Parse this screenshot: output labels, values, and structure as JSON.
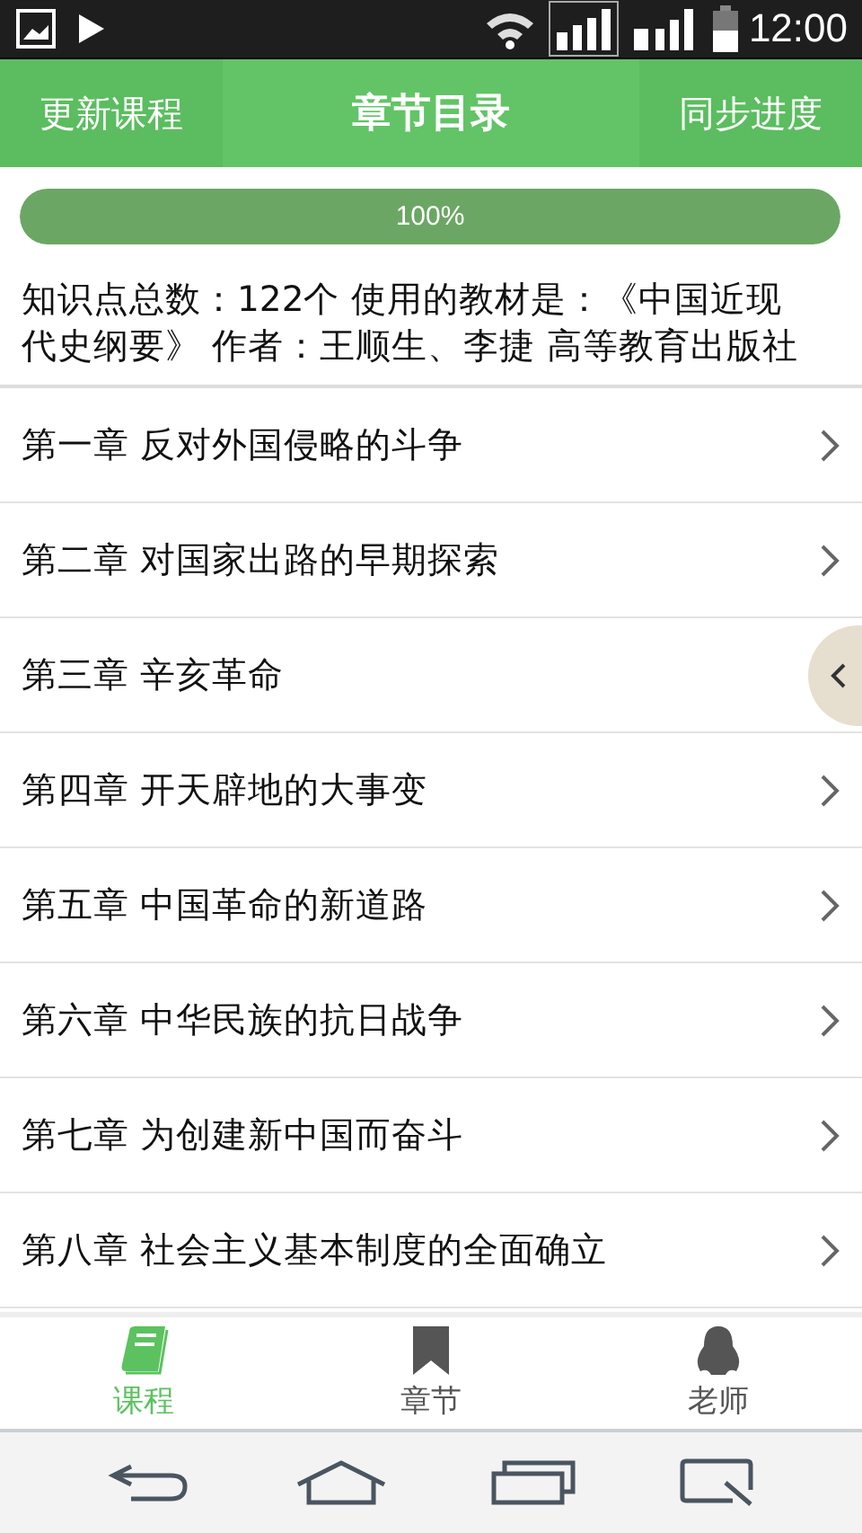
{
  "status_bar": {
    "time": "12:00"
  },
  "header": {
    "left_button": "更新课程",
    "title": "章节目录",
    "right_button": "同步进度"
  },
  "progress": {
    "level": 1,
    "reading": "100%"
  },
  "info": "知识点总数：122个 使用的教材是：《中国近现代史纲要》 作者：王顺生、李捷 高等教育出版社",
  "chapters": [
    {
      "title": "第一章 反对外国侵略的斗争",
      "covered": false
    },
    {
      "title": "第二章 对国家出路的早期探索",
      "covered": false
    },
    {
      "title": "第三章 辛亥革命",
      "covered": true
    },
    {
      "title": "第四章 开天辟地的大事变",
      "covered": false
    },
    {
      "title": "第五章 中国革命的新道路",
      "covered": false
    },
    {
      "title": "第六章 中华民族的抗日战争",
      "covered": false
    },
    {
      "title": "第七章 为创建新中国而奋斗",
      "covered": false
    },
    {
      "title": "第八章 社会主义基本制度的全面确立",
      "covered": false
    }
  ],
  "tabs": [
    {
      "label": "课程",
      "kind": "book",
      "selected": true
    },
    {
      "label": "章节",
      "kind": "bookmark",
      "selected": false
    },
    {
      "label": "老师",
      "kind": "penguin",
      "selected": false
    }
  ]
}
